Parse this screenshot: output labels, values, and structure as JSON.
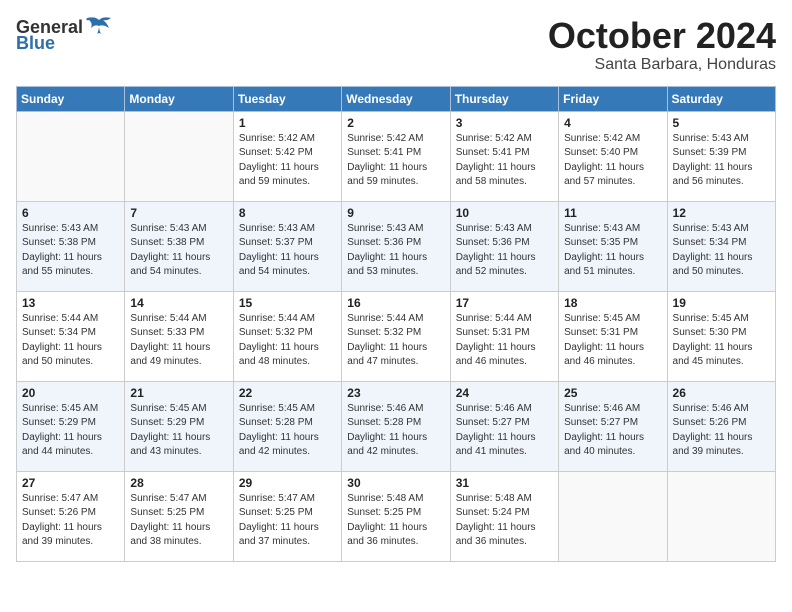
{
  "logo": {
    "general": "General",
    "blue": "Blue"
  },
  "title": "October 2024",
  "location": "Santa Barbara, Honduras",
  "days_of_week": [
    "Sunday",
    "Monday",
    "Tuesday",
    "Wednesday",
    "Thursday",
    "Friday",
    "Saturday"
  ],
  "weeks": [
    [
      {
        "day": "",
        "info": ""
      },
      {
        "day": "",
        "info": ""
      },
      {
        "day": "1",
        "info": "Sunrise: 5:42 AM\nSunset: 5:42 PM\nDaylight: 11 hours\nand 59 minutes."
      },
      {
        "day": "2",
        "info": "Sunrise: 5:42 AM\nSunset: 5:41 PM\nDaylight: 11 hours\nand 59 minutes."
      },
      {
        "day": "3",
        "info": "Sunrise: 5:42 AM\nSunset: 5:41 PM\nDaylight: 11 hours\nand 58 minutes."
      },
      {
        "day": "4",
        "info": "Sunrise: 5:42 AM\nSunset: 5:40 PM\nDaylight: 11 hours\nand 57 minutes."
      },
      {
        "day": "5",
        "info": "Sunrise: 5:43 AM\nSunset: 5:39 PM\nDaylight: 11 hours\nand 56 minutes."
      }
    ],
    [
      {
        "day": "6",
        "info": "Sunrise: 5:43 AM\nSunset: 5:38 PM\nDaylight: 11 hours\nand 55 minutes."
      },
      {
        "day": "7",
        "info": "Sunrise: 5:43 AM\nSunset: 5:38 PM\nDaylight: 11 hours\nand 54 minutes."
      },
      {
        "day": "8",
        "info": "Sunrise: 5:43 AM\nSunset: 5:37 PM\nDaylight: 11 hours\nand 54 minutes."
      },
      {
        "day": "9",
        "info": "Sunrise: 5:43 AM\nSunset: 5:36 PM\nDaylight: 11 hours\nand 53 minutes."
      },
      {
        "day": "10",
        "info": "Sunrise: 5:43 AM\nSunset: 5:36 PM\nDaylight: 11 hours\nand 52 minutes."
      },
      {
        "day": "11",
        "info": "Sunrise: 5:43 AM\nSunset: 5:35 PM\nDaylight: 11 hours\nand 51 minutes."
      },
      {
        "day": "12",
        "info": "Sunrise: 5:43 AM\nSunset: 5:34 PM\nDaylight: 11 hours\nand 50 minutes."
      }
    ],
    [
      {
        "day": "13",
        "info": "Sunrise: 5:44 AM\nSunset: 5:34 PM\nDaylight: 11 hours\nand 50 minutes."
      },
      {
        "day": "14",
        "info": "Sunrise: 5:44 AM\nSunset: 5:33 PM\nDaylight: 11 hours\nand 49 minutes."
      },
      {
        "day": "15",
        "info": "Sunrise: 5:44 AM\nSunset: 5:32 PM\nDaylight: 11 hours\nand 48 minutes."
      },
      {
        "day": "16",
        "info": "Sunrise: 5:44 AM\nSunset: 5:32 PM\nDaylight: 11 hours\nand 47 minutes."
      },
      {
        "day": "17",
        "info": "Sunrise: 5:44 AM\nSunset: 5:31 PM\nDaylight: 11 hours\nand 46 minutes."
      },
      {
        "day": "18",
        "info": "Sunrise: 5:45 AM\nSunset: 5:31 PM\nDaylight: 11 hours\nand 46 minutes."
      },
      {
        "day": "19",
        "info": "Sunrise: 5:45 AM\nSunset: 5:30 PM\nDaylight: 11 hours\nand 45 minutes."
      }
    ],
    [
      {
        "day": "20",
        "info": "Sunrise: 5:45 AM\nSunset: 5:29 PM\nDaylight: 11 hours\nand 44 minutes."
      },
      {
        "day": "21",
        "info": "Sunrise: 5:45 AM\nSunset: 5:29 PM\nDaylight: 11 hours\nand 43 minutes."
      },
      {
        "day": "22",
        "info": "Sunrise: 5:45 AM\nSunset: 5:28 PM\nDaylight: 11 hours\nand 42 minutes."
      },
      {
        "day": "23",
        "info": "Sunrise: 5:46 AM\nSunset: 5:28 PM\nDaylight: 11 hours\nand 42 minutes."
      },
      {
        "day": "24",
        "info": "Sunrise: 5:46 AM\nSunset: 5:27 PM\nDaylight: 11 hours\nand 41 minutes."
      },
      {
        "day": "25",
        "info": "Sunrise: 5:46 AM\nSunset: 5:27 PM\nDaylight: 11 hours\nand 40 minutes."
      },
      {
        "day": "26",
        "info": "Sunrise: 5:46 AM\nSunset: 5:26 PM\nDaylight: 11 hours\nand 39 minutes."
      }
    ],
    [
      {
        "day": "27",
        "info": "Sunrise: 5:47 AM\nSunset: 5:26 PM\nDaylight: 11 hours\nand 39 minutes."
      },
      {
        "day": "28",
        "info": "Sunrise: 5:47 AM\nSunset: 5:25 PM\nDaylight: 11 hours\nand 38 minutes."
      },
      {
        "day": "29",
        "info": "Sunrise: 5:47 AM\nSunset: 5:25 PM\nDaylight: 11 hours\nand 37 minutes."
      },
      {
        "day": "30",
        "info": "Sunrise: 5:48 AM\nSunset: 5:25 PM\nDaylight: 11 hours\nand 36 minutes."
      },
      {
        "day": "31",
        "info": "Sunrise: 5:48 AM\nSunset: 5:24 PM\nDaylight: 11 hours\nand 36 minutes."
      },
      {
        "day": "",
        "info": ""
      },
      {
        "day": "",
        "info": ""
      }
    ]
  ]
}
